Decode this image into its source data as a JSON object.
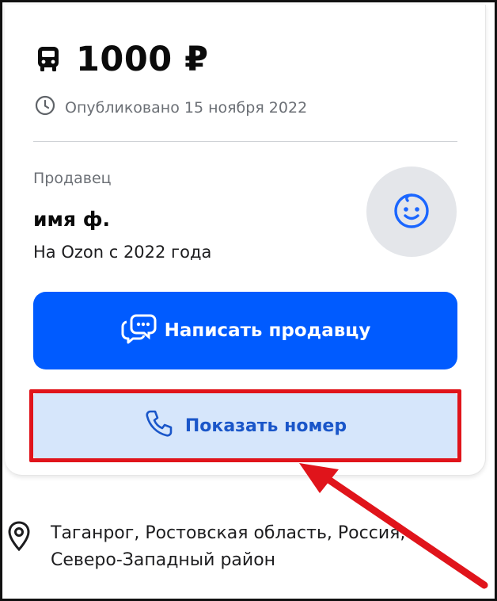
{
  "listing": {
    "price": "1000 ₽",
    "published": "Опубликовано 15 ноября 2022"
  },
  "seller": {
    "label": "Продавец",
    "name": "имя ф.",
    "since": "На Ozon с 2022 года"
  },
  "actions": {
    "write_label": "Написать продавцу",
    "show_number_label": "Показать номер"
  },
  "location": {
    "line1": "Таганрог, Ростовская область, Россия,",
    "line2": "Северо-Западный район"
  },
  "icons": {
    "price": "bus-icon",
    "published": "clock-icon",
    "avatar": "smiley-face-icon",
    "write": "chat-bubbles-icon",
    "show_number": "phone-icon",
    "location": "map-pin-icon"
  },
  "colors": {
    "primary": "#005bff",
    "secondary_bg": "#d6e6fb",
    "secondary_text": "#1a56c9",
    "annotation": "#e0141b"
  }
}
